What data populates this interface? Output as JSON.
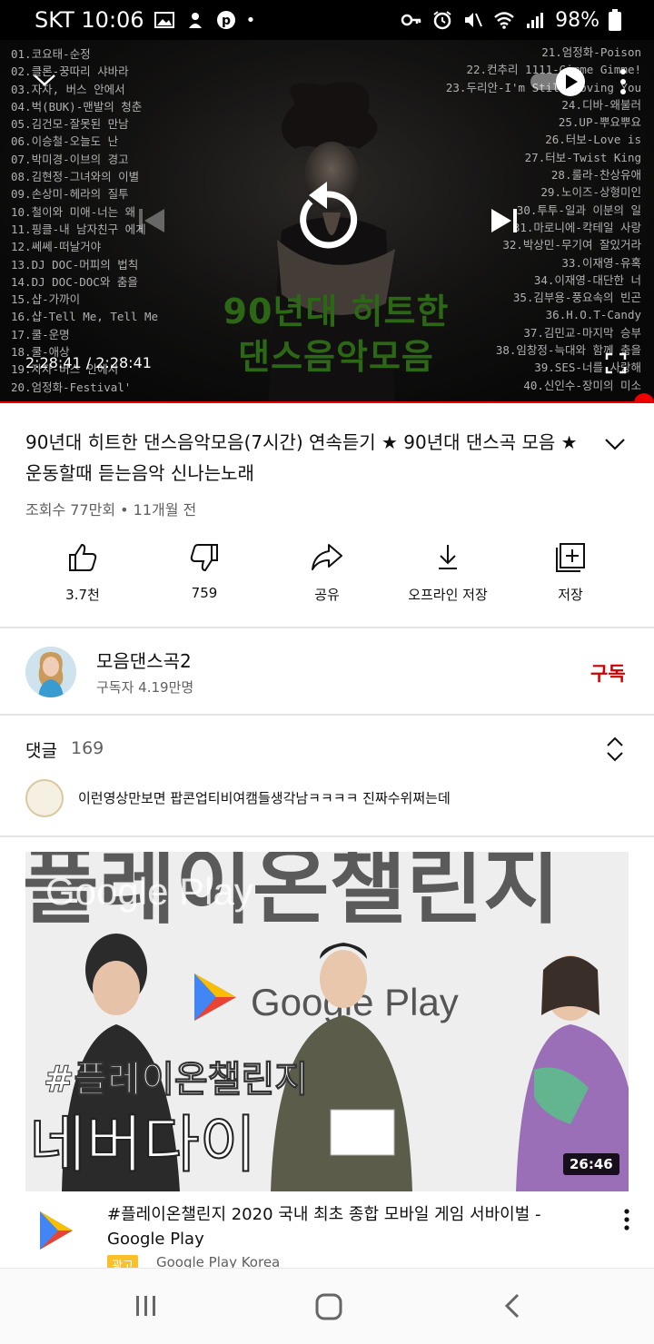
{
  "status_bar": {
    "carrier_time": "SKT 10:06",
    "battery": "98%"
  },
  "player": {
    "time": "2:28:41 / 2:28:41",
    "overlay_title_line1": "90년대 히트한",
    "overlay_title_line2": "댄스음악모음",
    "tracklist_left": "01.코요태-순정\n02.클론-꿍따리 샤바라\n03.자자, 버스 안에서\n04.벅(BUK)-맨발의 청춘\n05.김건모-잘못된 만남\n06.이승철-오늘도 난\n07.박미경-이브의 경고\n08.김현정-그녀와의 이별\n09.손상미-헤라의 질투\n10.철이와 미애-너는 왜\n11.핑클-내 남자친구 에게\n12.쎄쎄-떠날거야\n13.DJ DOC-머피의 법칙\n14.DJ DOC-DOC와 춤을\n15.샵-가까이\n16.샵-Tell Me, Tell Me\n17.쿨-운명\n18.쿨-애상\n19.자자-버스 안에서\n20.엄정화-Festival'",
    "tracklist_right": "21.엄정화-Poison\n22.컨추리 1111-Gimme Gimme!\n23.두리안-I'm Still Loving You\n24.디바-왜불러\n25.UP-뿌요뿌요\n26.터보-Love is\n27.터보-Twist King\n28.룰라-찬상유애\n29.노이즈-상형미인\n30.투투-일과 이분의 일\n31.마로니에-칵테일 사랑\n32.박상민-무기여 잘있거라\n33.이재영-유혹\n34.이재영-대단한 너\n35.김부용-풍요속의 빈곤\n36.H.O.T-Candy\n37.김민교-마지막 승부\n38.임창정-늑대와 함께 춤을\n39.SES-너를 사랑해\n40.신인수-장미의 미소",
    "progress": 1.0
  },
  "video": {
    "title": "90년대 히트한 댄스음악모음(7시간) 연속듣기 ★ 90년대 댄스곡 모음 ★ 운동할때 듣는음악 신나는노래",
    "meta": "조회수 77만회 • 11개월 전"
  },
  "actions": {
    "like": "3.7천",
    "dislike": "759",
    "share": "공유",
    "offline": "오프라인 저장",
    "save": "저장"
  },
  "channel": {
    "name": "모음댄스곡2",
    "subscribers": "구독자 4.19만명",
    "subscribe_label": "구독"
  },
  "comments": {
    "label": "댓글",
    "count": "169",
    "top_comment": "이런영상만보면 팝콘업티비여캠들생각남ㅋㅋㅋㅋ 진짜수위쩌는데"
  },
  "ad": {
    "thumb_banner": "플레이온챌린지",
    "thumb_brand_overlay": "Google Play",
    "thumb_brand_center": "Google Play",
    "thumb_hashtag": "#플레이온챌린지",
    "thumb_subtitle": "네버다이",
    "duration": "26:46",
    "title": "#플레이온챌린지 2020 국내 최초 종합 모바일 게임 서바이벌 - Google Play",
    "badge": "광고",
    "channel": "Google Play Korea"
  },
  "colors": {
    "accent_red": "#cc0000",
    "progress_red": "#ee0000",
    "ad_badge": "#f9c02a"
  }
}
